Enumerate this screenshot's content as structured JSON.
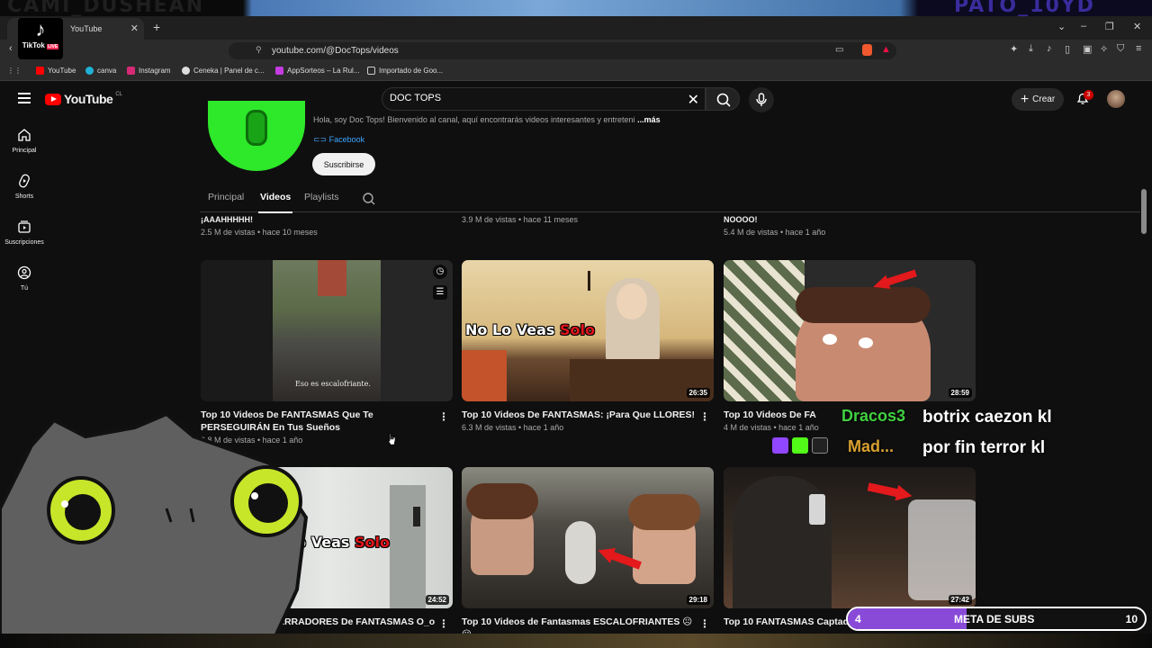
{
  "browser": {
    "tab_title": "YouTube",
    "new_tab": "+",
    "url": "youtube.com/@DocTops/videos",
    "bookmarks": [
      "YouTube",
      "canva",
      "Instagram",
      "Ceneka | Panel de c...",
      "AppSorteos – La Rul...",
      "Importado de Goo..."
    ],
    "window_controls": [
      "⌄",
      "–",
      "❐",
      "✕"
    ]
  },
  "stream": {
    "top_left_text": "CAMI_DUSHEAN",
    "top_right_text": "PATO_10YD",
    "tiktok_label": "TikTok",
    "tiktok_live": "LIVE"
  },
  "youtube": {
    "logo_text": "YouTube",
    "region": "CL",
    "search_value": "DOC TOPS",
    "create_label": "Crear",
    "notif_count": "3",
    "sidebar": [
      {
        "label": "Principal",
        "icon": "home-icon"
      },
      {
        "label": "Shorts",
        "icon": "shorts-icon"
      },
      {
        "label": "Suscripciones",
        "icon": "subscriptions-icon"
      },
      {
        "label": "Tú",
        "icon": "you-icon"
      }
    ],
    "channel": {
      "description": "Hola, soy Doc Tops! Bienvenido al canal, aquí encontrarás videos interesantes y entreteni",
      "more": "...más",
      "link": "Facebook",
      "subscribe_label": "Suscribirse"
    },
    "tabs": [
      "Principal",
      "Videos",
      "Playlists"
    ],
    "active_tab": "Videos",
    "partial_row": [
      {
        "title": "¡AAAHHHHH!",
        "meta": "2.5 M de vistas • hace 10 meses"
      },
      {
        "title": "",
        "meta": "3.9 M de vistas • hace 11 meses"
      },
      {
        "title": "NOOOO!",
        "meta": "5.4 M de vistas • hace 1 año"
      }
    ],
    "videos": [
      {
        "title": "Top 10 Videos De FANTASMAS Que Te PERSEGUIRÁN En Tus Sueños",
        "meta": "6.8 M de vistas • hace 1 año",
        "duration": "",
        "overlay_caption": "Eso es escalofriante."
      },
      {
        "title": "Top 10 Videos De FANTASMAS: ¡Para Que LLORES!",
        "meta": "6.3 M de vistas • hace 1 año",
        "duration": "26:35",
        "overlay_white": "No Lo Veas",
        "overlay_red": "Solo"
      },
      {
        "title": "Top 10 Videos De FA",
        "meta": "4 M de vistas • hace 1 año",
        "duration": "28:59"
      },
      {
        "title": "Top 10 Videos ATERRADORES De FANTASMAS O_o",
        "meta": "",
        "duration": "24:52",
        "overlay_white": "No Lo Veas",
        "overlay_red": "Solo"
      },
      {
        "title": "Top 10 Videos de Fantasmas ESCALOFRIANTES ☹︎☹︎",
        "meta": "",
        "duration": "29:18"
      },
      {
        "title": "Top 10 FANTASMAS Captad",
        "meta": "",
        "duration": "27:42"
      }
    ]
  },
  "overlay": {
    "chat": [
      {
        "user": "Dracos3",
        "message": "botrix caezon kl",
        "color": "#40d040"
      },
      {
        "user": "Mad...",
        "message": "por fin terror kl",
        "color": "#d8a030"
      }
    ],
    "goal": {
      "current": "4",
      "label": "META DE SUBS",
      "target": "10",
      "progress": 0.4,
      "color": "#8a4ad8"
    }
  },
  "colors": {
    "accent": "#ff0000",
    "link": "#3ea6ff",
    "channel_green": "#2ee82a"
  }
}
